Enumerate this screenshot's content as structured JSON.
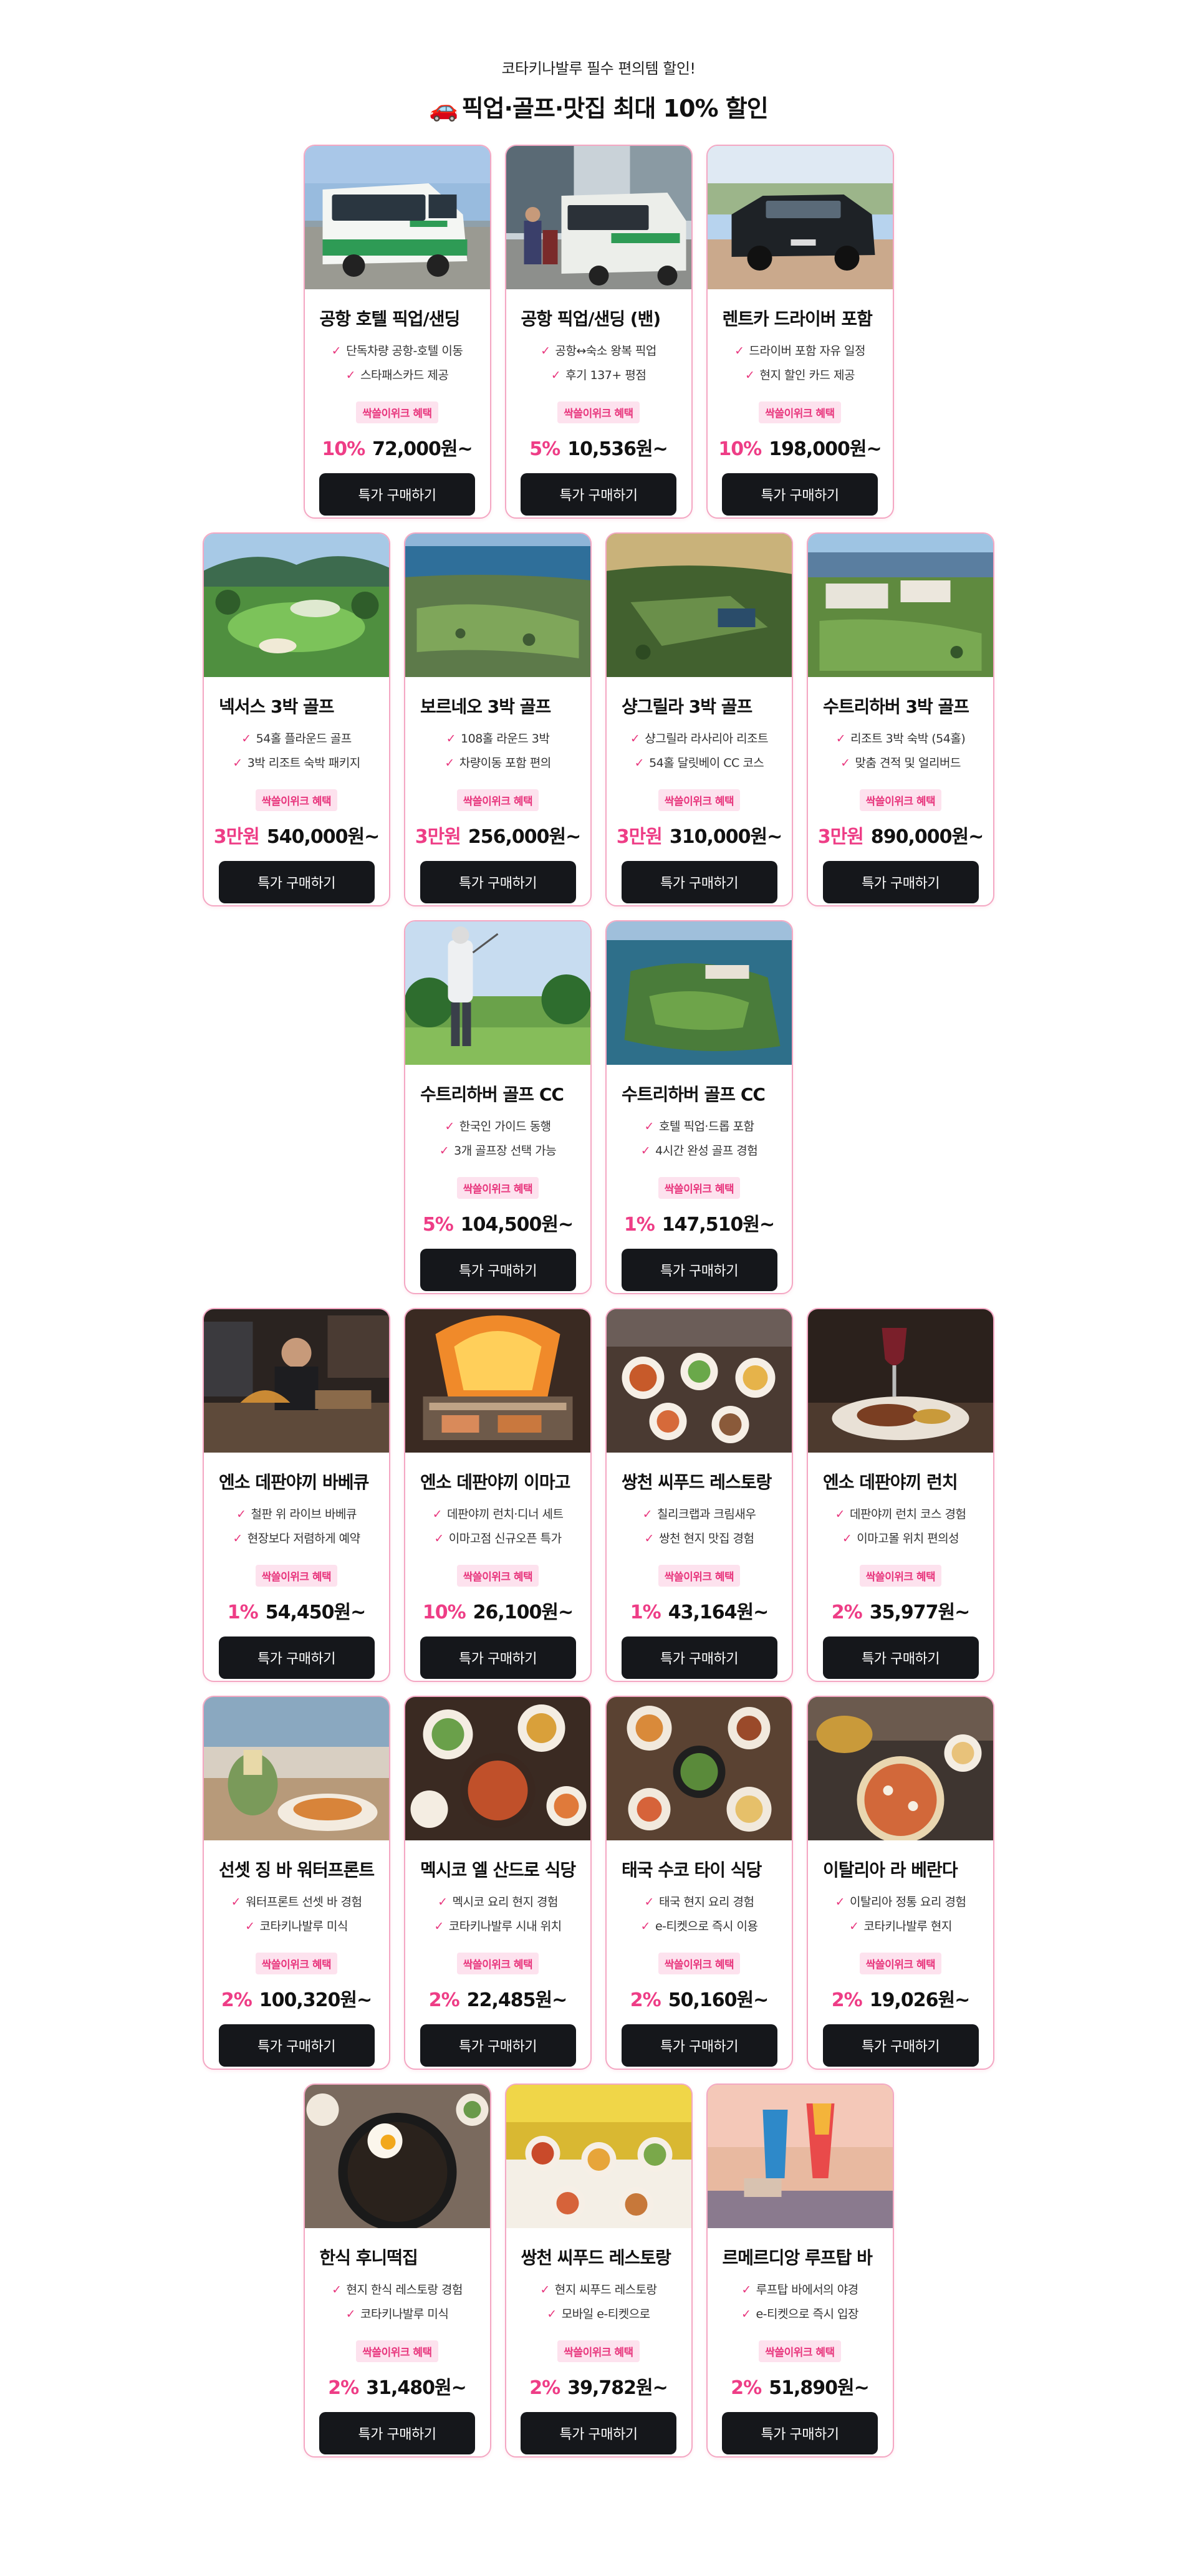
{
  "header": {
    "subtitle": "코타키나발루 필수 편의템 할인!",
    "title_icon": "🚗",
    "title": "픽업·골프·맛집 최대 10% 할인"
  },
  "common": {
    "badge": "싹쓸이위크 혜택",
    "buy_label": "특가 구매하기",
    "check": "✓"
  },
  "rows": [
    {
      "cards": [
        {
          "title": "공항 호텔 픽업/샌딩",
          "features": [
            "단독차량 공항-호텔 이동",
            "스타패스카드 제공"
          ],
          "discount": "10%",
          "price": "72,000원~",
          "photo": "van-green"
        },
        {
          "title": "공항 픽업/샌딩 (밴)",
          "features": [
            "공항↔숙소 왕복 픽업",
            "후기 137+ 평점"
          ],
          "discount": "5%",
          "price": "10,536원~",
          "photo": "van-white"
        },
        {
          "title": "렌트카 드라이버 포함",
          "features": [
            "드라이버 포함 자유 일정",
            "현지 할인 카드 제공"
          ],
          "discount": "10%",
          "price": "198,000원~",
          "photo": "car-black"
        }
      ]
    },
    {
      "cards": [
        {
          "title": "넥서스 3박 골프",
          "features": [
            "54홀 플라운드 골프",
            "3박 리조트 숙박 패키지"
          ],
          "discount": "3만원",
          "price": "540,000원~",
          "photo": "golf-course"
        },
        {
          "title": "보르네오 3박 골프",
          "features": [
            "108홀 라운드 3박",
            "차량이동 포함 편의"
          ],
          "discount": "3만원",
          "price": "256,000원~",
          "photo": "golf-aerial-coast"
        },
        {
          "title": "샹그릴라 3박 골프",
          "features": [
            "샹그릴라 라사리아 리조트",
            "54홀 달릿베이 CC 코스"
          ],
          "discount": "3만원",
          "price": "310,000원~",
          "photo": "golf-aerial-sunset"
        },
        {
          "title": "수트리하버 3박 골프",
          "features": [
            "리조트 3박 숙박 (54홀)",
            "맞춤 견적 및 얼리버드"
          ],
          "discount": "3만원",
          "price": "890,000원~",
          "photo": "golf-resort"
        }
      ]
    },
    {
      "cards": [
        {
          "title": "수트리하버 골프 CC",
          "features": [
            "한국인 가이드 동행",
            "3개 골프장 선택 가능"
          ],
          "discount": "5%",
          "price": "104,500원~",
          "photo": "golfer"
        },
        {
          "title": "수트리하버 골프 CC",
          "features": [
            "호텔 픽업·드롭 포함",
            "4시간 완성 골프 경험"
          ],
          "discount": "1%",
          "price": "147,510원~",
          "photo": "golf-island"
        }
      ]
    },
    {
      "cards": [
        {
          "title": "엔소 데판야끼 바베큐",
          "features": [
            "철판 위 라이브 바베큐",
            "현장보다 저렴하게 예약"
          ],
          "discount": "1%",
          "price": "54,450원~",
          "photo": "teppan-chef"
        },
        {
          "title": "엔소 데판야끼 이마고",
          "features": [
            "데판야끼 런치·디너 세트",
            "이마고점 신규오픈 특가"
          ],
          "discount": "10%",
          "price": "26,100원~",
          "photo": "grill-fire"
        },
        {
          "title": "쌍천 씨푸드 레스토랑",
          "features": [
            "칠리크랩과 크림새우",
            "쌍천 현지 맛집 경험"
          ],
          "discount": "1%",
          "price": "43,164원~",
          "photo": "seafood-table"
        },
        {
          "title": "엔소 데판야끼 런치",
          "features": [
            "데판야끼 런치 코스 경험",
            "이마고몰 위치 편의성"
          ],
          "discount": "2%",
          "price": "35,977원~",
          "photo": "steak-wine"
        }
      ]
    },
    {
      "cards": [
        {
          "title": "선셋 징 바 워터프론트",
          "features": [
            "워터프론트 선셋 바 경험",
            "코타키나발루 미식"
          ],
          "discount": "2%",
          "price": "100,320원~",
          "photo": "sunset-bar"
        },
        {
          "title": "멕시코 엘 산드로 식당",
          "features": [
            "멕시코 요리 현지 경험",
            "코타키나발루 시내 위치"
          ],
          "discount": "2%",
          "price": "22,485원~",
          "photo": "mexican"
        },
        {
          "title": "태국 수코 타이 식당",
          "features": [
            "태국 현지 요리 경험",
            "e-티켓으로 즉시 이용"
          ],
          "discount": "2%",
          "price": "50,160원~",
          "photo": "thai"
        },
        {
          "title": "이탈리아 라 베란다",
          "features": [
            "이탈리아 정통 요리 경험",
            "코타키나발루 현지"
          ],
          "discount": "2%",
          "price": "19,026원~",
          "photo": "italian"
        }
      ]
    },
    {
      "cards": [
        {
          "title": "한식 후니떡집",
          "features": [
            "현지 한식 레스토랑 경험",
            "코타키나발루 미식"
          ],
          "discount": "2%",
          "price": "31,480원~",
          "photo": "korean"
        },
        {
          "title": "쌍천 씨푸드 레스토랑",
          "features": [
            "현지 씨푸드 레스토랑",
            "모바일 e-티켓으로"
          ],
          "discount": "2%",
          "price": "39,782원~",
          "photo": "seafood-yellow"
        },
        {
          "title": "르메르디앙 루프탑 바",
          "features": [
            "루프탑 바에서의 야경",
            "e-티켓으로 즉시 입장"
          ],
          "discount": "2%",
          "price": "51,890원~",
          "photo": "rooftop-drinks"
        }
      ]
    }
  ],
  "colors": {
    "accent": "#ee3d86",
    "border": "#f4a7c3",
    "badge_bg": "#fde2ee",
    "button_bg": "#15171b"
  }
}
